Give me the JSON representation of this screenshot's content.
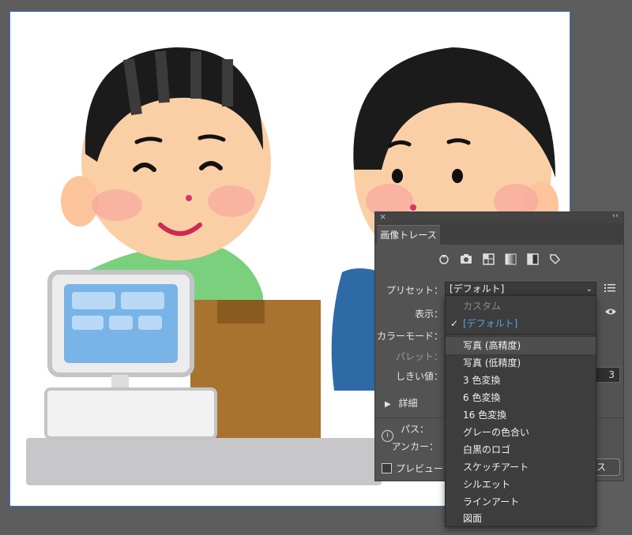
{
  "artboard": {
    "border_color": "#3a6fd8"
  },
  "panel": {
    "close_glyph": "×",
    "collapse_glyph": "‹‹",
    "tab_title": "画像トレース",
    "icons": [
      "auto-color-icon",
      "camera-icon",
      "grid-icon",
      "gradient-icon",
      "half-contrast-icon",
      "tag-icon"
    ],
    "labels": {
      "preset": "プリセット：",
      "view": "表示：",
      "mode": "カラーモード：",
      "palette": "パレット：",
      "threshold": "しきい値："
    },
    "preset_value": "[デフォルト]",
    "threshold_value": "3",
    "details": "詳細",
    "paths_label": "パス：",
    "anchors_label": "アンカー：",
    "preview_label": "プレビュー",
    "trace_button": "ス"
  },
  "dropdown": {
    "items": [
      {
        "label": "カスタム",
        "state": "disabled"
      },
      {
        "label": "[デフォルト]",
        "state": "selected"
      },
      {
        "label": "写真 (高精度)",
        "state": "hover"
      },
      {
        "label": "写真 (低精度)",
        "state": ""
      },
      {
        "label": "3 色変換",
        "state": ""
      },
      {
        "label": "6 色変換",
        "state": ""
      },
      {
        "label": "16 色変換",
        "state": ""
      },
      {
        "label": "グレーの色合い",
        "state": ""
      },
      {
        "label": "白黒のロゴ",
        "state": ""
      },
      {
        "label": "スケッチアート",
        "state": ""
      },
      {
        "label": "シルエット",
        "state": ""
      },
      {
        "label": "ラインアート",
        "state": ""
      },
      {
        "label": "図面",
        "state": ""
      }
    ]
  },
  "colors": {
    "accent": "#5aa0f0",
    "panel_bg": "#535353",
    "canvas_bg": "#5d5d5d"
  }
}
